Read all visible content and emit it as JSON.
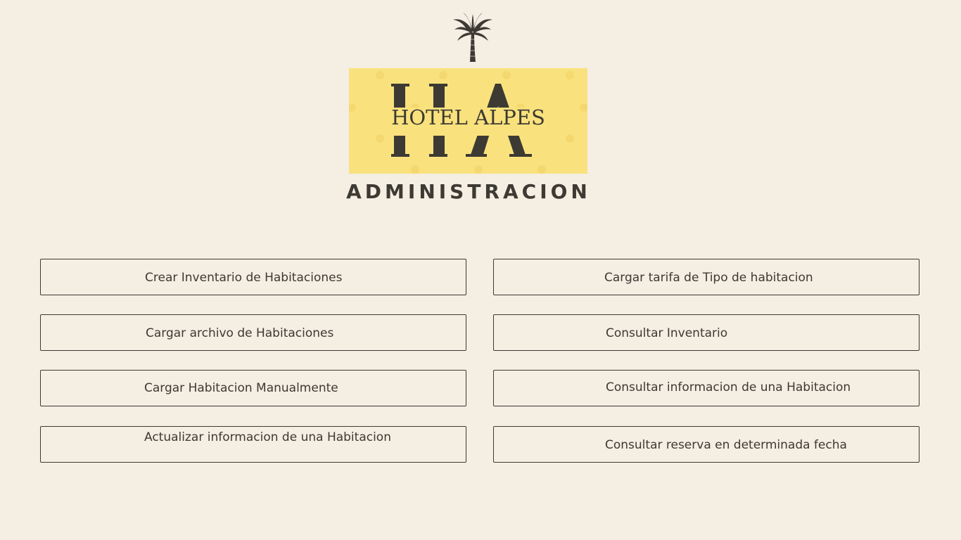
{
  "branding": {
    "hotel_name": "HOTEL ALPES",
    "monogram": "HA",
    "palm_icon": "palm-tree-icon",
    "logo_background": "#f9e27d"
  },
  "page": {
    "title": "ADMINISTRACION",
    "background": "#f4eee3",
    "text_color": "#3d3a33"
  },
  "menu": {
    "left": [
      "Crear Inventario de Habitaciones",
      "Cargar archivo de Habitaciones",
      "Cargar Habitacion Manualmente",
      "Actualizar informacion de una Habitacion"
    ],
    "right": [
      "Cargar tarifa de Tipo de habitacion",
      "Consultar Inventario",
      "Consultar informacion de una Habitacion",
      "Consultar reserva en determinada fecha"
    ]
  }
}
